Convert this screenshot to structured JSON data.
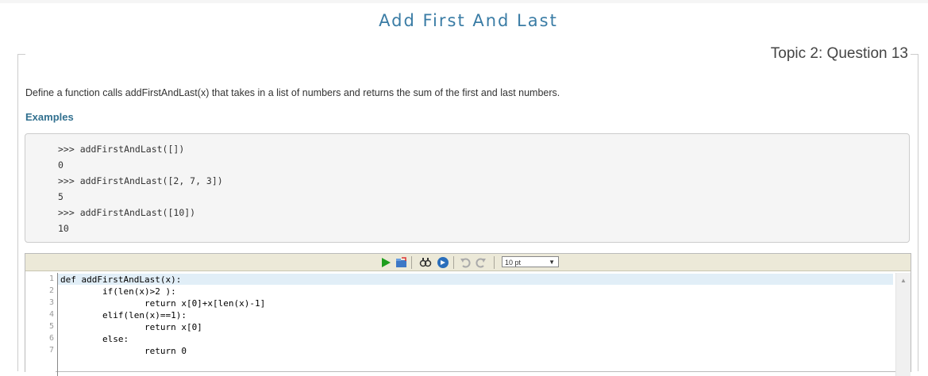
{
  "page": {
    "title": "Add First And Last",
    "topic_label": "Topic 2: Question 13"
  },
  "question": {
    "text": "Define a function calls addFirstAndLast(x) that takes in a list of numbers and returns the sum of the first and last numbers.",
    "examples_heading": "Examples",
    "example_lines": [
      ">>> addFirstAndLast([])",
      "0",
      ">>> addFirstAndLast([2, 7, 3])",
      "5",
      ">>> addFirstAndLast([10])",
      "10"
    ]
  },
  "editor": {
    "font_size": "10 pt",
    "toolbar_icons": [
      "run-icon",
      "open-file-icon",
      "search-replace-icon",
      "go-to-icon",
      "undo-icon",
      "redo-icon"
    ],
    "line_numbers": [
      "1",
      "2",
      "3",
      "4",
      "5",
      "6",
      "7"
    ],
    "code_lines": [
      "def addFirstAndLast(x):",
      "        if(len(x)>2 ):",
      "                return x[0]+x[len(x)-1]",
      "        elif(len(x)==1):",
      "                return x[0]",
      "        else:",
      "                return 0"
    ]
  },
  "colors": {
    "title": "#3a7ca5",
    "examples_heading": "#31708f",
    "toolbar_bg": "#ece9d8",
    "active_line": "#e1eef7"
  }
}
